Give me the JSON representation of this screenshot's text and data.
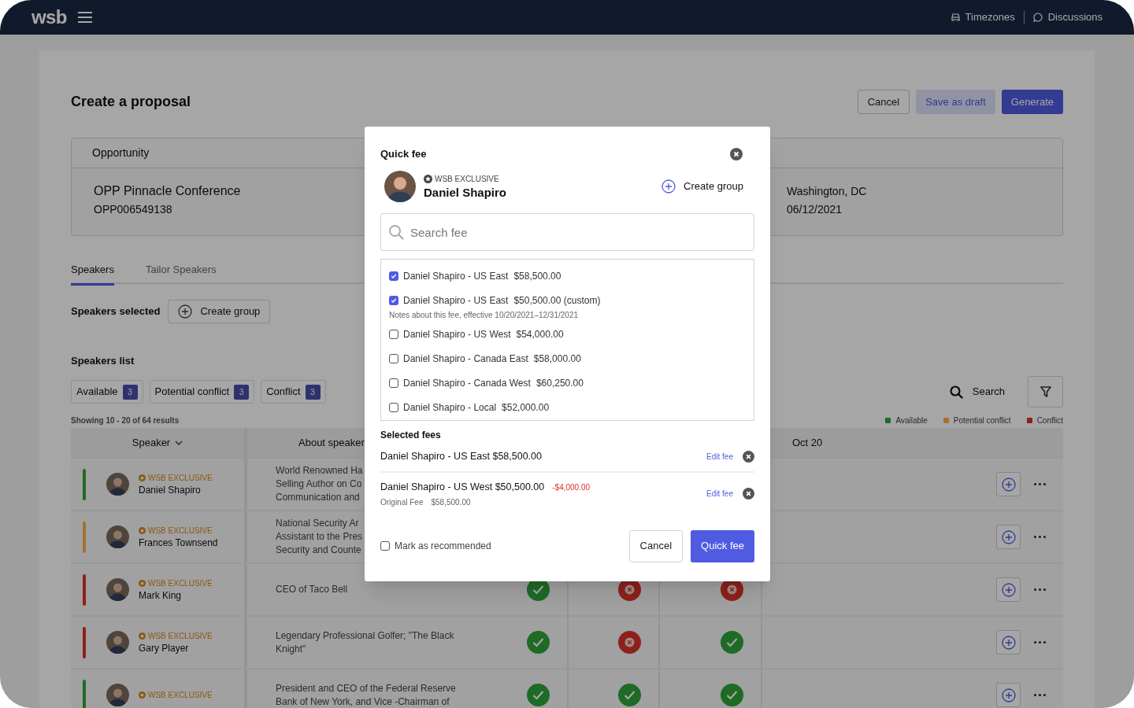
{
  "top_bar": {
    "logo": "wsb",
    "links": [
      {
        "kind": "car",
        "label": "Timezones"
      },
      {
        "kind": "chat",
        "label": "Discussions"
      }
    ]
  },
  "page": {
    "title": "Create a proposal",
    "actions": [
      {
        "kind": "secondary",
        "label": "Cancel"
      },
      {
        "kind": "soft",
        "label": "Save as draft"
      },
      {
        "kind": "primary",
        "label": "Generate"
      }
    ]
  },
  "opportunity": {
    "heading": "Opportunity",
    "name": "OPP Pinnacle Conference",
    "id": "OPP006549138",
    "location": "Washington, DC",
    "date": "06/12/2021"
  },
  "tabs": [
    {
      "label": "Speakers",
      "selected": true
    },
    {
      "label": "Tailor Speakers",
      "selected": false
    }
  ],
  "speakers_selected": {
    "label": "Speakers selected",
    "button": "Create group"
  },
  "speakers_list": {
    "title": "Speakers list",
    "filters": [
      {
        "label": "Available",
        "count": "3"
      },
      {
        "label": "Potential conflict",
        "count": "3"
      },
      {
        "label": "Conflict",
        "count": "3"
      }
    ],
    "search": "Search",
    "showing": "Showing 10 - 20 of 64 results",
    "legend": [
      {
        "kind": "available",
        "label": "Available",
        "color": "#1e6b26"
      },
      {
        "kind": "potential",
        "label": "Potential conflict",
        "color": "#a5702e"
      },
      {
        "kind": "conflict",
        "label": "Conflict",
        "color": "#8d221c"
      }
    ]
  },
  "table": {
    "columns": [
      {
        "label": "Speaker",
        "sorted": true
      },
      {
        "label": "About speaker"
      },
      {
        "label": "Oct 20"
      }
    ],
    "rows": [
      {
        "kind": "available",
        "tag": "WSB EXCLUSIVE",
        "name": "Daniel Shapiro",
        "about": [
          "World Renowned Ha",
          "Selling Author on Co",
          "Communication and"
        ]
      },
      {
        "kind": "potential",
        "tag": "WSB EXCLUSIVE",
        "name": "Frances Townsend",
        "about": [
          "National Security Ar",
          "Assistant to the Pres",
          "Security and Counte"
        ]
      },
      {
        "kind": "conflict",
        "tag": "WSB EXCLUSIVE",
        "name": "Mark King",
        "about": [
          "CEO of Taco Bell"
        ],
        "cells": [
          {
            "kind": "available"
          },
          {
            "kind": "conflict"
          },
          {
            "kind": "conflict"
          }
        ]
      },
      {
        "kind": "conflict",
        "tag": "WSB EXCLUSIVE",
        "name": "Gary Player",
        "about": [
          "Legendary Professional Golfer; \"The Black",
          "Knight\""
        ],
        "cells": [
          {
            "kind": "available"
          },
          {
            "kind": "conflict"
          },
          {
            "kind": "available"
          }
        ]
      },
      {
        "kind": "available",
        "tag": "WSB EXCLUSIVE",
        "about": [
          "President and CEO of the Federal Reserve",
          "Bank of New York, and Vice -Chairman of"
        ],
        "cells": [
          {
            "kind": "available"
          },
          {
            "kind": "available"
          },
          {
            "kind": "available"
          }
        ]
      }
    ]
  },
  "modal": {
    "title": "Quick fee",
    "speaker": {
      "tag": "WSB EXCLUSIVE",
      "name": "Daniel Shapiro"
    },
    "create_group": "Create group",
    "search": {
      "placeholder": "Search fee"
    },
    "fees": [
      {
        "label": "Daniel Shapiro - US East",
        "amount": "$58,500.00",
        "checked": true
      },
      {
        "label": "Daniel Shapiro - US East",
        "amount": "$50,500.00 (custom)",
        "checked": true,
        "note": "Notes about this fee, effective 10/20/2021–12/31/2021"
      },
      {
        "label": "Daniel Shapiro - US West",
        "amount": "$54,000.00",
        "checked": false
      },
      {
        "label": "Daniel Shapiro - Canada East",
        "amount": "$58,000.00",
        "checked": false
      },
      {
        "label": "Daniel Shapiro - Canada West",
        "amount": "$60,250.00",
        "checked": false
      },
      {
        "label": "Daniel Shapiro - Local",
        "amount": "$52,000.00",
        "checked": false
      }
    ],
    "selected_title": "Selected fees",
    "selected": [
      {
        "name": "Daniel Shapiro - US East $58,500.00",
        "action": "Edit fee"
      },
      {
        "name": "Daniel Shapiro - US West $50,500.00",
        "discount": "-$4,000.00",
        "original_label": "Original Fee",
        "original": "$58,500.00",
        "action": "Edit fee"
      }
    ],
    "recommend": {
      "label": "Mark as recommended",
      "checked": false
    },
    "buttons": [
      {
        "kind": "secondary",
        "label": "Cancel"
      },
      {
        "kind": "primary",
        "label": "Quick fee"
      }
    ]
  }
}
